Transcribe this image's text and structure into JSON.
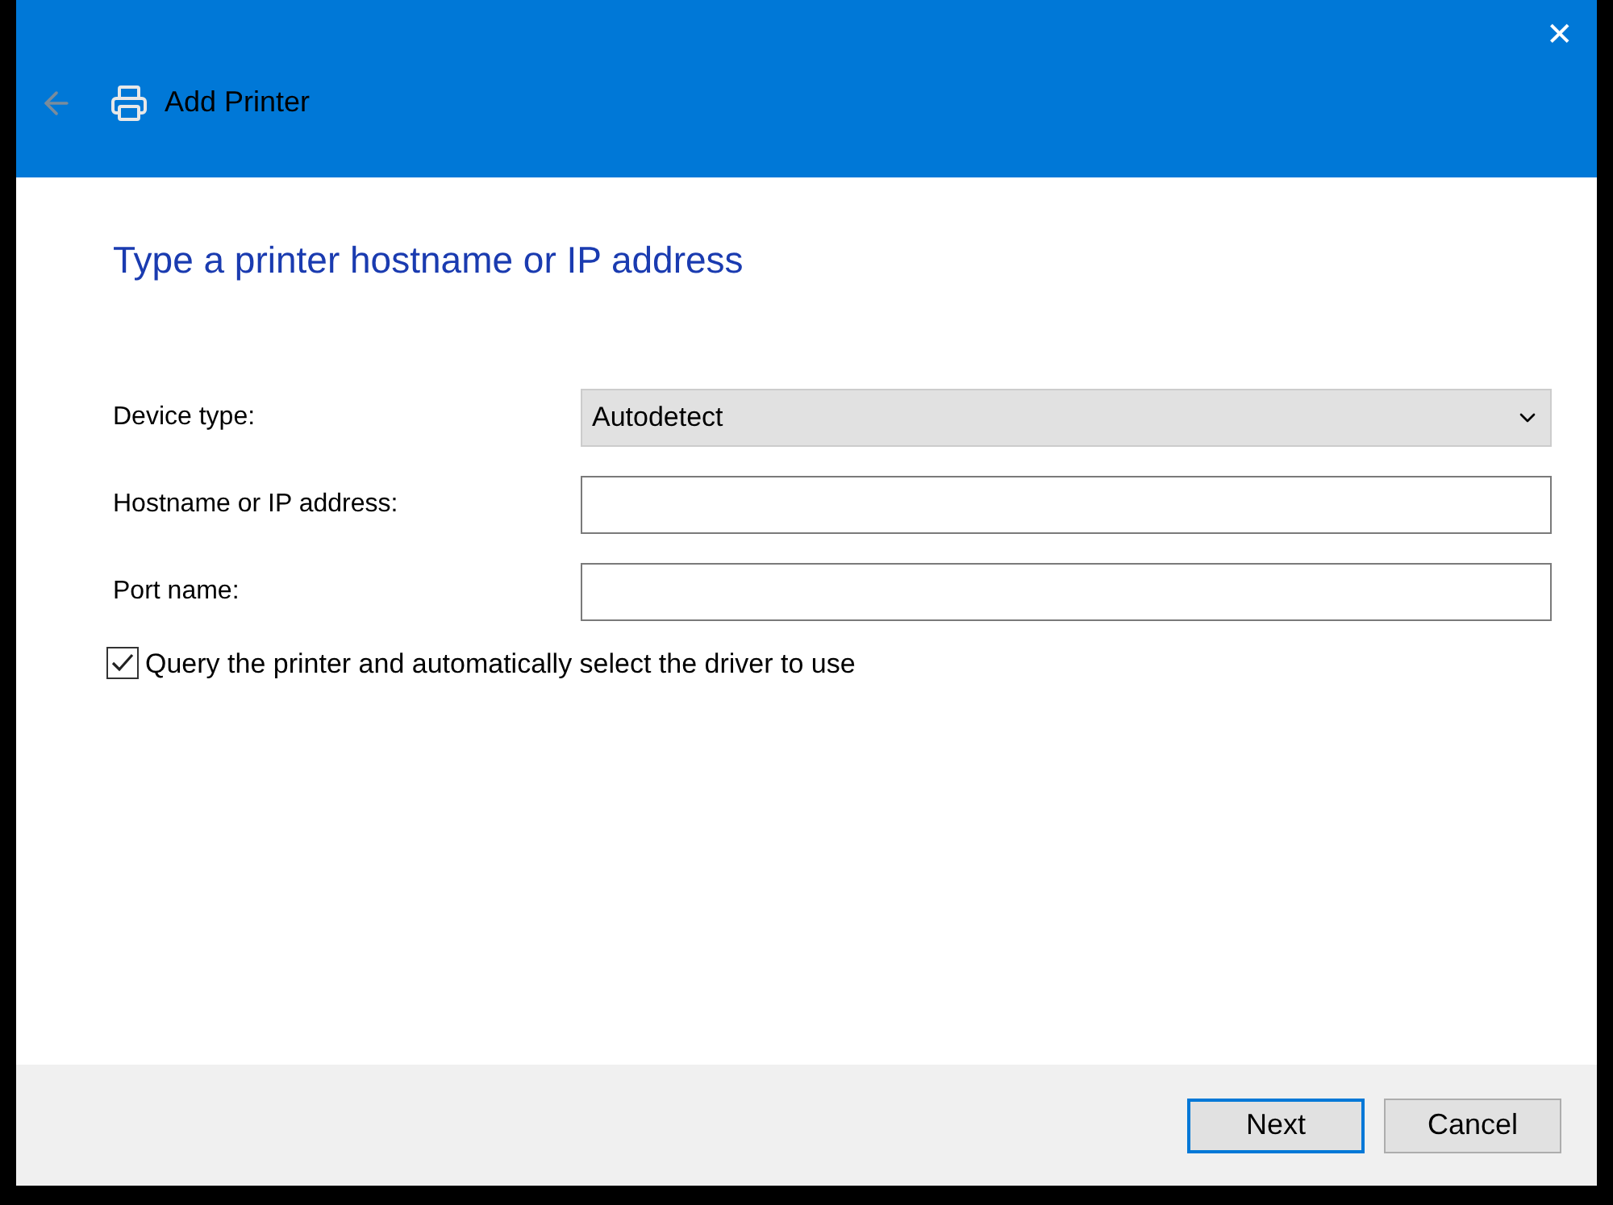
{
  "window": {
    "title": "Add Printer",
    "close": "✕"
  },
  "heading": "Type a printer hostname or IP address",
  "fields": [
    {
      "kind": "dropdown",
      "label": "Device type:",
      "value": "Autodetect"
    },
    {
      "kind": "text",
      "label": "Hostname or IP address:"
    },
    {
      "kind": "text",
      "label": "Port name:"
    }
  ],
  "option": {
    "label": "Query the printer and automatically select the driver to use",
    "checked": true
  },
  "buttons": [
    {
      "label": "Next",
      "default": true
    },
    {
      "label": "Cancel",
      "default": false
    }
  ]
}
